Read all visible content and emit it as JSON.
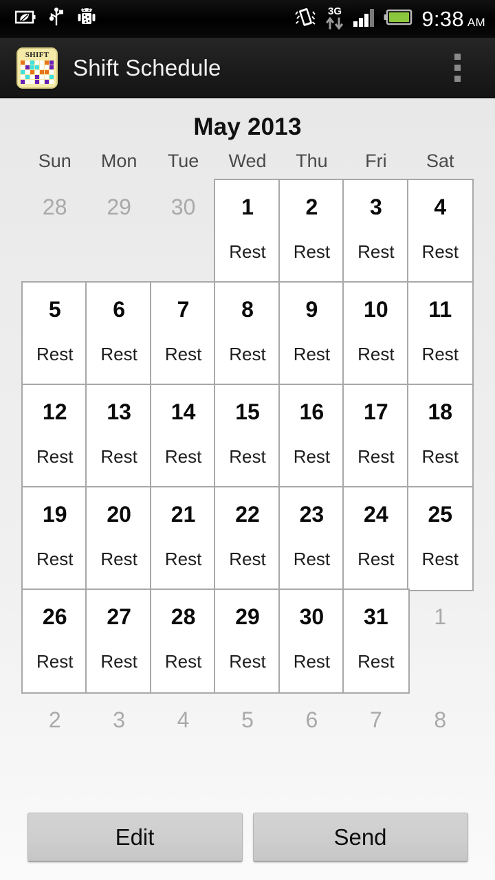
{
  "statusbar": {
    "left_icons": [
      "eco-battery-icon",
      "usb-icon",
      "android-debug-icon"
    ],
    "right_icons": [
      "vibrate-icon",
      "3g-data-icon",
      "signal-bars-icon",
      "battery-icon"
    ],
    "network_label": "3G",
    "signal_bars_filled": 3,
    "signal_bars_total": 4,
    "time": "9:38",
    "ampm": "AM",
    "battery_color": "#8cc63f"
  },
  "actionbar": {
    "icon_word": "SHIFT",
    "icon_bg": "#f6eaa8",
    "icon_cell_colors": [
      "#e8751a",
      "#ffffff",
      "#3fe0e0",
      "#ffffff",
      "#ffffff",
      "#e8751a",
      "#6a1fb8",
      "#ffffff",
      "#6a1fb8",
      "#3fe0e0",
      "#3fe0e0",
      "#ffffff",
      "#ffffff",
      "#6a1fb8",
      "#3fe0e0",
      "#ffffff",
      "#e8751a",
      "#ffffff",
      "#e8751a",
      "#e8751a",
      "#ffffff",
      "#ffffff",
      "#3fe0e0",
      "#ffffff",
      "#6a1fb8",
      "#ffffff",
      "#ffffff",
      "#3fe0e0",
      "#6a1fb8",
      "#ffffff",
      "#ffffff",
      "#6a1fb8",
      "#ffffff",
      "#6a1fb8",
      "#ffffff"
    ],
    "title": "Shift Schedule",
    "overflow_label": "More options"
  },
  "calendar": {
    "month_title": "May 2013",
    "weekdays": [
      "Sun",
      "Mon",
      "Tue",
      "Wed",
      "Thu",
      "Fri",
      "Sat"
    ],
    "days": [
      {
        "n": "28",
        "shift": "",
        "in_month": false
      },
      {
        "n": "29",
        "shift": "",
        "in_month": false
      },
      {
        "n": "30",
        "shift": "",
        "in_month": false
      },
      {
        "n": "1",
        "shift": "Rest",
        "in_month": true
      },
      {
        "n": "2",
        "shift": "Rest",
        "in_month": true
      },
      {
        "n": "3",
        "shift": "Rest",
        "in_month": true
      },
      {
        "n": "4",
        "shift": "Rest",
        "in_month": true
      },
      {
        "n": "5",
        "shift": "Rest",
        "in_month": true
      },
      {
        "n": "6",
        "shift": "Rest",
        "in_month": true
      },
      {
        "n": "7",
        "shift": "Rest",
        "in_month": true
      },
      {
        "n": "8",
        "shift": "Rest",
        "in_month": true
      },
      {
        "n": "9",
        "shift": "Rest",
        "in_month": true
      },
      {
        "n": "10",
        "shift": "Rest",
        "in_month": true
      },
      {
        "n": "11",
        "shift": "Rest",
        "in_month": true
      },
      {
        "n": "12",
        "shift": "Rest",
        "in_month": true
      },
      {
        "n": "13",
        "shift": "Rest",
        "in_month": true
      },
      {
        "n": "14",
        "shift": "Rest",
        "in_month": true
      },
      {
        "n": "15",
        "shift": "Rest",
        "in_month": true
      },
      {
        "n": "16",
        "shift": "Rest",
        "in_month": true
      },
      {
        "n": "17",
        "shift": "Rest",
        "in_month": true
      },
      {
        "n": "18",
        "shift": "Rest",
        "in_month": true
      },
      {
        "n": "19",
        "shift": "Rest",
        "in_month": true
      },
      {
        "n": "20",
        "shift": "Rest",
        "in_month": true
      },
      {
        "n": "21",
        "shift": "Rest",
        "in_month": true
      },
      {
        "n": "22",
        "shift": "Rest",
        "in_month": true
      },
      {
        "n": "23",
        "shift": "Rest",
        "in_month": true
      },
      {
        "n": "24",
        "shift": "Rest",
        "in_month": true
      },
      {
        "n": "25",
        "shift": "Rest",
        "in_month": true
      },
      {
        "n": "26",
        "shift": "Rest",
        "in_month": true
      },
      {
        "n": "27",
        "shift": "Rest",
        "in_month": true
      },
      {
        "n": "28",
        "shift": "Rest",
        "in_month": true
      },
      {
        "n": "29",
        "shift": "Rest",
        "in_month": true
      },
      {
        "n": "30",
        "shift": "Rest",
        "in_month": true
      },
      {
        "n": "31",
        "shift": "Rest",
        "in_month": true
      },
      {
        "n": "1",
        "shift": "",
        "in_month": false
      }
    ],
    "trailing_days": [
      "2",
      "3",
      "4",
      "5",
      "6",
      "7",
      "8"
    ]
  },
  "buttons": {
    "edit_label": "Edit",
    "send_label": "Send"
  }
}
